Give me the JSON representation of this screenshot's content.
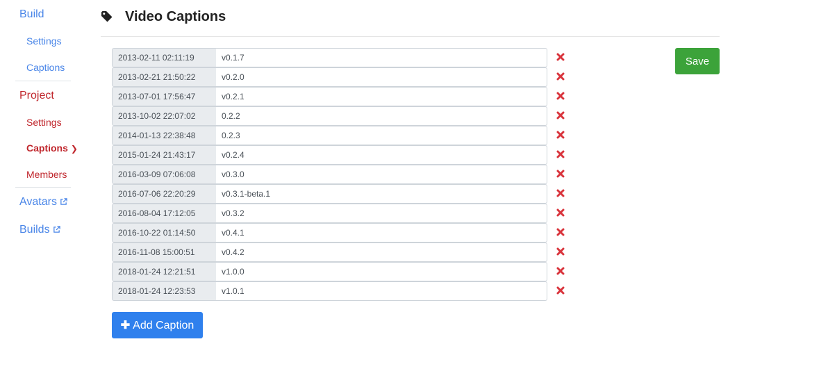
{
  "sidebar": {
    "build": {
      "label": "Build",
      "items": [
        {
          "label": "Settings"
        },
        {
          "label": "Captions"
        }
      ]
    },
    "project": {
      "label": "Project",
      "items": [
        {
          "label": "Settings"
        },
        {
          "label": "Captions"
        },
        {
          "label": "Members"
        }
      ]
    },
    "avatars": {
      "label": "Avatars"
    },
    "builds": {
      "label": "Builds"
    }
  },
  "header": {
    "title": "Video Captions"
  },
  "captions": [
    {
      "time": "2013-02-11 02:11:19",
      "version": "v0.1.7"
    },
    {
      "time": "2013-02-21 21:50:22",
      "version": "v0.2.0"
    },
    {
      "time": "2013-07-01 17:56:47",
      "version": "v0.2.1"
    },
    {
      "time": "2013-10-02 22:07:02",
      "version": "0.2.2"
    },
    {
      "time": "2014-01-13 22:38:48",
      "version": "0.2.3"
    },
    {
      "time": "2015-01-24 21:43:17",
      "version": "v0.2.4"
    },
    {
      "time": "2016-03-09 07:06:08",
      "version": "v0.3.0"
    },
    {
      "time": "2016-07-06 22:20:29",
      "version": "v0.3.1-beta.1"
    },
    {
      "time": "2016-08-04 17:12:05",
      "version": "v0.3.2"
    },
    {
      "time": "2016-10-22 01:14:50",
      "version": "v0.4.1"
    },
    {
      "time": "2016-11-08 15:00:51",
      "version": "v0.4.2"
    },
    {
      "time": "2018-01-24 12:21:51",
      "version": "v1.0.0"
    },
    {
      "time": "2018-01-24 12:23:53",
      "version": "v1.0.1"
    }
  ],
  "buttons": {
    "save": "Save",
    "add_caption": "Add Caption"
  },
  "colors": {
    "link_blue": "#4a86e8",
    "project_red": "#c0262c",
    "delete_red": "#d9343c",
    "save_green": "#3ca33a",
    "add_blue": "#2f80ed"
  }
}
